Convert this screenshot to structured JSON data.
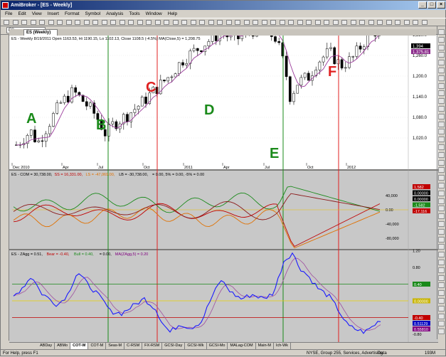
{
  "window": {
    "title": "AmiBroker - [ES - Weekly]",
    "controls": [
      "_",
      "□",
      "×"
    ]
  },
  "menu": [
    "File",
    "Edit",
    "View",
    "Insert",
    "Format",
    "Symbol",
    "Analysis",
    "Tools",
    "Window",
    "Help"
  ],
  "toolbar": {
    "symbol": "ES",
    "doc_tab": "ES (Weekly)"
  },
  "panes": {
    "price": {
      "header": "ES - Weekly 8/19/2011 Open 1163.53, Hi 1190.15, Lo 1102.13, Close 1108.5 (-4.5%) MA(Close,5) = 1,208.75",
      "y_ticks": [
        "1,320.0",
        "1,260.0",
        "1,200.0",
        "1,140.0",
        "1,080.0",
        "1,020.0"
      ],
      "last_price": "1,394",
      "last_ma": "1,375.81",
      "x_ticks": [
        "Dec 2010",
        "Apr",
        "Jul",
        "Oct",
        "2011",
        "Apr",
        "Jul",
        "Oct",
        "2012"
      ],
      "markers": [
        {
          "label": "A",
          "color": "#1a8a1a"
        },
        {
          "label": "B",
          "color": "#1a8a1a"
        },
        {
          "label": "C",
          "color": "#e02020"
        },
        {
          "label": "D",
          "color": "#1a8a1a"
        },
        {
          "label": "E",
          "color": "#1a8a1a"
        },
        {
          "label": "F",
          "color": "#e02020"
        }
      ]
    },
    "cot": {
      "header_parts": [
        {
          "text": "ES - COM = 30,738.00, ",
          "color": "#000000"
        },
        {
          "text": "SS = 16,331.00, ",
          "color": "#c00000"
        },
        {
          "text": "LS = -47,069.00, ",
          "color": "#e07000"
        },
        {
          "text": "LB = -30,738.00, ",
          "color": "#000000"
        },
        {
          "text": "= 0.00, 5% = 0.00, -5% = 0.00",
          "color": "#000000"
        }
      ],
      "y_ticks": [
        "40,000",
        "0.00",
        "-40,000",
        "-80,000"
      ],
      "badges": [
        {
          "text": "1,582",
          "bg": "#c00000"
        },
        {
          "text": "0.00000",
          "bg": "#000000"
        },
        {
          "text": "0.00000",
          "bg": "#000000"
        },
        {
          "text": "-1,582",
          "bg": "#1a8a1a"
        },
        {
          "text": "-17,116",
          "bg": "#c00000"
        }
      ]
    },
    "zagg": {
      "header_parts": [
        {
          "text": "ES - ZAgg = 0.51, ",
          "color": "#000000"
        },
        {
          "text": "Bear = -0.40, ",
          "color": "#c00000"
        },
        {
          "text": "Bull = 0.40, ",
          "color": "#1a8a1a"
        },
        {
          "text": "= 0.00, ",
          "color": "#000000"
        },
        {
          "text": "MA(ZAgg,5) = 0.20",
          "color": "#800080"
        }
      ],
      "y_ticks": [
        "1.20",
        "0.80",
        "0.40",
        "0.00",
        "-0.40",
        "-0.80"
      ],
      "badges": [
        {
          "text": "0.40",
          "bg": "#1a8a1a"
        },
        {
          "text": "0.00000",
          "bg": "#c8b400"
        },
        {
          "text": "-0.40",
          "bg": "#c00000"
        },
        {
          "text": "0.51129",
          "bg": "#0000c0"
        },
        {
          "text": "0.55810",
          "bg": "#800080"
        }
      ]
    }
  },
  "sheet_tabs": [
    "ABDay",
    "ABMo",
    "COT-W",
    "COT-M",
    "Seas-M",
    "C-RSM",
    "FX-RSM",
    "GCSI-Day",
    "GCSI-Wk",
    "GCSI-Mo",
    "MALag-COM",
    "Main-M",
    "Ich-Wk"
  ],
  "active_sheet": "COT-W",
  "status": {
    "left": "For Help, press F1",
    "mid": "NYSE, Group 255, Services, Advertising",
    "data": "Data",
    "mem": "193M"
  },
  "colors": {
    "price_bg": "#ffffff",
    "cot_bg": "#c8c8c8",
    "zagg_bg": "#c8c8c8",
    "green_vline": "#1a8a1a",
    "red_vline": "#e02020",
    "ma_line": "#9b3b9b",
    "zagg_line": "#1a1aff"
  }
}
